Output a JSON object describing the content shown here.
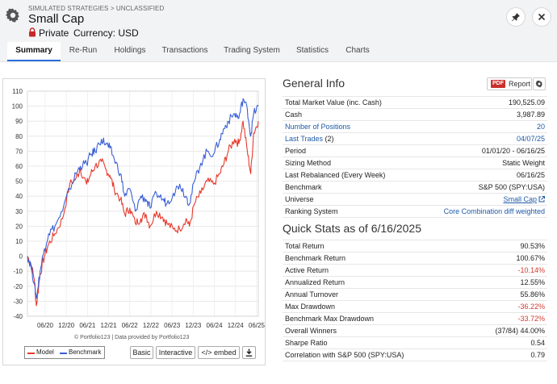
{
  "header": {
    "breadcrumb": "SIMULATED STRATEGIES > UNCLASSIFIED",
    "title": "Small Cap",
    "privacy": "Private",
    "currency": "Currency: USD",
    "icons": [
      "gear-icon",
      "lock-icon",
      "pin-icon",
      "close-icon"
    ]
  },
  "tabs": [
    "Summary",
    "Re-Run",
    "Holdings",
    "Transactions",
    "Trading System",
    "Statistics",
    "Charts"
  ],
  "active_tab": "Summary",
  "chart": {
    "credit": "© Portfolio123 | Data provided by Portfolio123",
    "legend": [
      "Model",
      "Benchmark"
    ],
    "buttons": {
      "basic": "Basic",
      "interactive": "Interactive",
      "embed": "</> embed"
    }
  },
  "chart_data": {
    "type": "line",
    "title": "",
    "xlabel": "",
    "ylabel": "",
    "x_ticks": [
      "06/20",
      "12/20",
      "06/21",
      "12/21",
      "06/22",
      "12/22",
      "06/23",
      "12/23",
      "06/24",
      "12/24",
      "06/25"
    ],
    "ylim": [
      -40,
      110
    ],
    "y_ticks": [
      -40,
      -30,
      -20,
      -10,
      0,
      10,
      20,
      30,
      40,
      50,
      60,
      70,
      80,
      90,
      100,
      110
    ],
    "grid": true,
    "legend_position": "bottom-left",
    "colors": {
      "Model": "#e8392b",
      "Benchmark": "#3a60d6"
    },
    "series": [
      {
        "name": "Model",
        "x": [
          2020.0,
          2020.08,
          2020.16,
          2020.21,
          2020.3,
          2020.4,
          2020.5,
          2020.65,
          2020.83,
          2021.0,
          2021.15,
          2021.25,
          2021.4,
          2021.5,
          2021.6,
          2021.75,
          2021.85,
          2021.95,
          2022.05,
          2022.2,
          2022.3,
          2022.42,
          2022.55,
          2022.68,
          2022.8,
          2022.9,
          2023.05,
          2023.2,
          2023.3,
          2023.45,
          2023.6,
          2023.75,
          2023.83,
          2023.95,
          2024.1,
          2024.25,
          2024.4,
          2024.55,
          2024.65,
          2024.75,
          2024.9,
          2025.0,
          2025.1,
          2025.2,
          2025.28,
          2025.35,
          2025.46
        ],
        "y": [
          0,
          -5,
          -15,
          -33,
          -12,
          0,
          8,
          15,
          25,
          48,
          52,
          58,
          48,
          55,
          60,
          63,
          58,
          54,
          45,
          38,
          28,
          32,
          22,
          25,
          28,
          20,
          30,
          26,
          22,
          18,
          18,
          25,
          20,
          35,
          42,
          50,
          48,
          55,
          62,
          70,
          78,
          75,
          90,
          70,
          55,
          82,
          90
        ]
      },
      {
        "name": "Benchmark",
        "x": [
          2020.0,
          2020.08,
          2020.16,
          2020.21,
          2020.3,
          2020.4,
          2020.5,
          2020.65,
          2020.83,
          2021.0,
          2021.15,
          2021.25,
          2021.4,
          2021.5,
          2021.6,
          2021.75,
          2021.85,
          2021.95,
          2022.05,
          2022.2,
          2022.3,
          2022.42,
          2022.55,
          2022.68,
          2022.8,
          2022.9,
          2023.05,
          2023.2,
          2023.3,
          2023.45,
          2023.6,
          2023.75,
          2023.83,
          2023.95,
          2024.1,
          2024.25,
          2024.4,
          2024.55,
          2024.65,
          2024.75,
          2024.9,
          2025.0,
          2025.1,
          2025.2,
          2025.28,
          2025.35,
          2025.46
        ],
        "y": [
          0,
          -6,
          -18,
          -28,
          -10,
          5,
          15,
          20,
          30,
          45,
          55,
          60,
          62,
          68,
          70,
          78,
          75,
          72,
          65,
          55,
          40,
          45,
          30,
          40,
          38,
          32,
          42,
          38,
          35,
          42,
          48,
          40,
          35,
          50,
          62,
          70,
          68,
          78,
          85,
          90,
          95,
          92,
          105,
          98,
          80,
          95,
          100
        ]
      }
    ]
  },
  "general_info": {
    "title": "General Info",
    "pdf_badge": "PDF",
    "pdf_label": "Report",
    "rows": [
      {
        "label": "Total Market Value (inc. Cash)",
        "value": "190,525.09"
      },
      {
        "label": "Cash",
        "value": "3,987.89"
      },
      {
        "label": "Number of Positions",
        "value": "20"
      },
      {
        "label": "Last Trades",
        "label_suffix": "(2)",
        "value": "04/07/25"
      },
      {
        "label": "Period",
        "value": "01/01/20 - 06/16/25"
      },
      {
        "label": "Sizing Method",
        "value": "Static Weight"
      },
      {
        "label": "Last Rebalanced (Every Week)",
        "value": "06/16/25"
      },
      {
        "label": "Benchmark",
        "value": "S&P 500 (SPY:USA)"
      },
      {
        "label": "Universe",
        "value": "Small Cap"
      },
      {
        "label": "Ranking System",
        "value": "Core Combination diff weighted"
      }
    ]
  },
  "quick_stats": {
    "title": "Quick Stats as of 6/16/2025",
    "rows": [
      {
        "label": "Total Return",
        "value": "90.53%"
      },
      {
        "label": "Benchmark Return",
        "value": "100.67%"
      },
      {
        "label": "Active Return",
        "value": "-10.14%"
      },
      {
        "label": "Annualized Return",
        "value": "12.55%"
      },
      {
        "label": "Annual Turnover",
        "value": "55.86%"
      },
      {
        "label": "Max Drawdown",
        "value": "-36.22%"
      },
      {
        "label": "Benchmark Max Drawdown",
        "value": "-33.72%"
      },
      {
        "label": "Overall Winners",
        "value": "(37/84) 44.00%"
      },
      {
        "label": "Sharpe Ratio",
        "value": "0.54"
      },
      {
        "label": "Correlation with S&P 500 (SPY:USA)",
        "value": "0.79"
      }
    ]
  }
}
